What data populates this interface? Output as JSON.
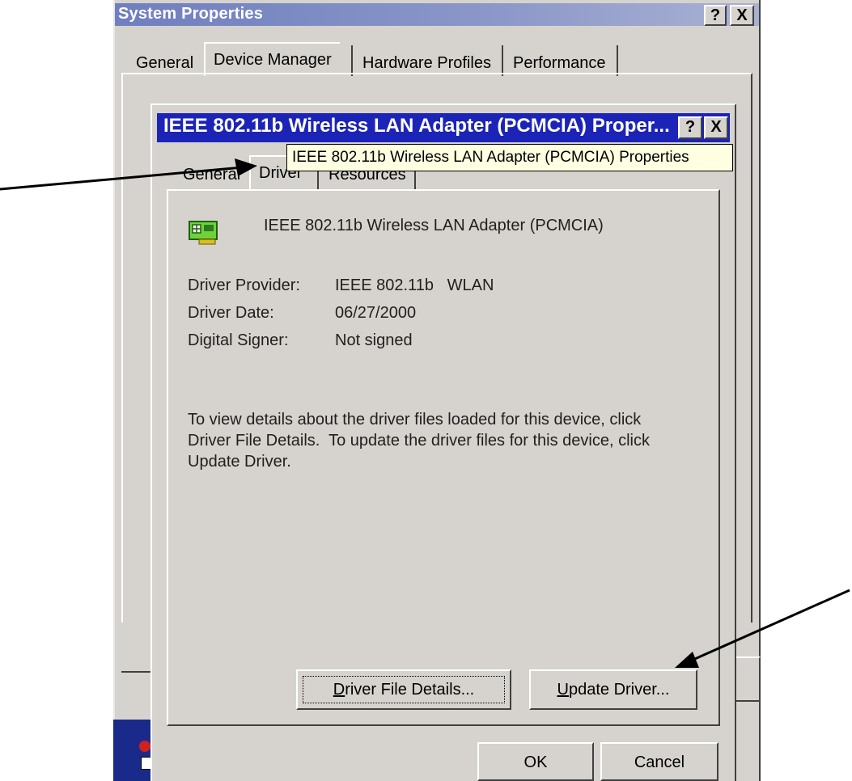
{
  "outer_window": {
    "title": "System Properties",
    "help_button": "?",
    "close_button": "X",
    "tabs": [
      {
        "label": "General"
      },
      {
        "label": "Device Manager"
      },
      {
        "label": "Hardware Profiles"
      },
      {
        "label": "Performance"
      }
    ],
    "bottom_buttons": {
      "ok": "OK",
      "cancel": "Cancel"
    }
  },
  "dialog": {
    "title": "IEEE 802.11b Wireless LAN Adapter (PCMCIA) Proper...",
    "help_button": "?",
    "close_button": "X",
    "tooltip": "IEEE 802.11b Wireless LAN Adapter (PCMCIA) Properties",
    "tabs": [
      {
        "label": "General"
      },
      {
        "label": "Driver"
      },
      {
        "label": "Resources"
      }
    ],
    "device_name": "IEEE 802.11b Wireless LAN Adapter (PCMCIA)",
    "fields": [
      {
        "label": "Driver Provider:",
        "value": "IEEE 802.11b   WLAN"
      },
      {
        "label": "Driver Date:",
        "value": "06/27/2000"
      },
      {
        "label": "Digital Signer:",
        "value": "Not signed"
      }
    ],
    "description_lines": [
      "To view details about the driver files loaded for this device, click",
      "Driver File Details.  To update the driver files for this device, click",
      "Update Driver."
    ],
    "buttons": {
      "driver_file_details": {
        "accel": "D",
        "rest": "river File Details..."
      },
      "update_driver": {
        "accel": "U",
        "rest": "pdate Driver..."
      }
    }
  },
  "colors": {
    "dialog_title_bar": "#1c24b8",
    "window_face": "#d6d3ce",
    "tooltip_bg": "#ffffe1"
  },
  "icons": {
    "device": "network-card-icon"
  }
}
